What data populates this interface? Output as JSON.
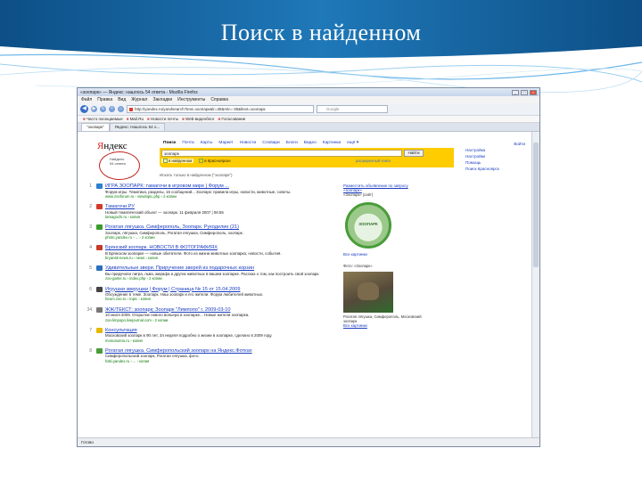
{
  "slide": {
    "title": "Поиск в найденном"
  },
  "browser": {
    "window_title": "«зоопарк» — Яндекс: нашлось 54 ответа - Mozilla Firefox",
    "menu": [
      "Файл",
      "Правка",
      "Вид",
      "Журнал",
      "Закладки",
      "Инструменты",
      "Справка"
    ],
    "url": "http://yandex.ru/yandsearch?text=зоопарк&lr=38&rstr=-38&ltext=зоопарк",
    "search_placeholder": "Google",
    "bookmarks": [
      "Часто посещаемые",
      "Mail.Ru",
      "Новости почты",
      "Web-видеоблог",
      "Голосование"
    ],
    "tabs": [
      "\"зоопарк\"",
      "Яндекс: Нашлось 54 о..."
    ],
    "status": "Готово"
  },
  "yandex": {
    "logo": {
      "ya": "Я",
      "rest": "ндекс"
    },
    "logo_sub": [
      "Найдено",
      "54 ответа"
    ],
    "nav": [
      "Поиск",
      "Почта",
      "Карты",
      "Маркет",
      "Новости",
      "Словари",
      "Блоги",
      "Видео",
      "Картинки",
      "ещё ▾"
    ],
    "login": "Войти",
    "query": "зоопарк",
    "find_button": "Найти",
    "filters": [
      "в найденном",
      "в Красноярске"
    ],
    "hint": "расширенный поиск",
    "found": "Искать только в найденном (\"зоопарк\")",
    "right_links": [
      "Настройка",
      "Настройки",
      "Помощь",
      "Поиск Красноярск"
    ],
    "results": [
      {
        "num": "1",
        "color": "#2f7fd0",
        "title": "ИГРА ЗООПАРК: тамагочи в игровом мире | Форум ...",
        "snippet": "Форум игры. Тематика, разделы, 16 сообщений... Зоопарк: правила игры, новости, животные, советы.",
        "url": "www.zooforum.ru › viewtopic.php › 2 копии"
      },
      {
        "num": "2",
        "color": "#d23b2a",
        "title": "Тамагочи.РУ",
        "snippet": "Новый тематический объект — зоопарк. 11 февраля 2007 | 06:55",
        "url": "tamagochi.ru › копия"
      },
      {
        "num": "3",
        "color": "#3a9c2a",
        "title": "Рогатая лягушка. Симферополь, Зоопарк. Рукоделие (21)",
        "snippet": "Зоопарк, лягушка, Симферополь, Рогатая лягушка, Симферополь, зоопарк.",
        "url": "photo.yandex.ru › ... › 2 копии"
      },
      {
        "num": "4",
        "color": "#c63a2a",
        "title": "Брянский зоопарк. НОВОСТИ В ФОТОГРАФИЯХ",
        "snippet": "В Брянском зоопарке — новые обитатели. Фото из жизни животных зоопарка, новости, события.",
        "url": "bryansk-news.ru › news › копия"
      },
      {
        "num": "5",
        "color": "#2a6fc0",
        "title": "Удивительные звери. Приручение зверей из подарочных корзин",
        "snippet": "Вы приручили лигра, льва, жирафа и других животных в вашем зоопарке. Рассказ о том, как построить свой зоопарк.",
        "url": "zoo-game.ru › index.php › 2 копии"
      },
      {
        "num": "6",
        "color": "#444444",
        "title": "Игрушки зверушки | Форум | Страница № 15 от 15.04.2009",
        "snippet": "Обсуждение в теме. Зоопарк. Наш зоопарк и его жители. Форум любителей животных.",
        "url": "forum.zoo.ru › topic › копия"
      },
      {
        "num": "34",
        "color": "#777777",
        "title": "ЖЖ/ТЕКСТ: зоопарк; Зоопарк \"Лимпопо\" г. 2009-03-10",
        "snippet": "10 июля 2009. Открытие нового вольера в зоопарке... Новые жители зоопарка.",
        "url": "zoo-limpopo.livejournal.com › 2 копии"
      },
      {
        "num": "7",
        "color": "#e6b800",
        "title": "Консультация",
        "snippet": "Московский зоопарк в 90 лет, 34 неделя подробно о жизни в зоопарке, сделано в 2009 году.",
        "url": "moscowzoo.ru › копия"
      },
      {
        "num": "8",
        "color": "#4a9c3a",
        "title": "Рогатая лягушка. Симферопольский зоопарк на Яндекс.Фотках",
        "snippet": "Симферопольский зоопарк, Рогатая лягушка, фото.",
        "url": "fotki.yandex.ru › ... › копия"
      }
    ],
    "side": {
      "ad_title": "Разместить объявление по запросу «зоопарк»",
      "zoo_text": "ЗООПАРК",
      "zoo_caption": "«Зоопарк» (сайт)",
      "more": "Все картинки",
      "photo_caption": "Фото: «Зоопарк»",
      "photo_sub": "Рогатая лягушка, Симферополь, Московский зоопарк",
      "more2": "Все картинки"
    }
  }
}
